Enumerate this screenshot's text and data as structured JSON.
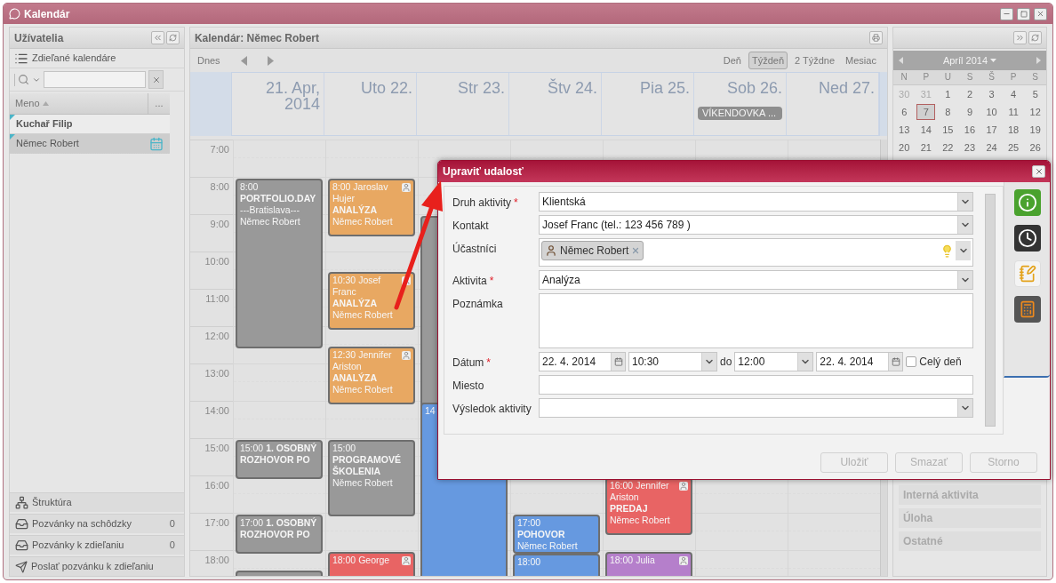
{
  "window": {
    "title": "Kalendár"
  },
  "users_panel": {
    "title": "Užívatelia",
    "shared_calendars": "Zdieľané kalendáre",
    "column": "Meno",
    "column_more": "...",
    "users": [
      {
        "name": "Kuchař Filip",
        "kind": "owner",
        "selected": false
      },
      {
        "name": "Němec Robert",
        "kind": "shared",
        "selected": true
      }
    ],
    "links": [
      {
        "label": "Štruktúra",
        "kind": "structure"
      },
      {
        "label": "Pozvánky na schôdzky",
        "kind": "inbox",
        "count": "0"
      },
      {
        "label": "Pozvánky k zdieľaniu",
        "kind": "inbox",
        "count": "0"
      },
      {
        "label": "Poslať pozvánku k zdieľaniu",
        "kind": "send"
      }
    ]
  },
  "calendar": {
    "title": "Kalendár: Němec Robert",
    "today": "Dnes",
    "views": [
      {
        "label": "Deň",
        "selected": false
      },
      {
        "label": "Týždeň",
        "selected": true
      },
      {
        "label": "2 Týždne",
        "selected": false
      },
      {
        "label": "Mesiac",
        "selected": false
      }
    ],
    "days": [
      {
        "label": "21. Apr, 2014"
      },
      {
        "label": "Uto 22."
      },
      {
        "label": "Str 23."
      },
      {
        "label": "Štv 24."
      },
      {
        "label": "Pia 25."
      },
      {
        "label": "Sob 26.",
        "all_day": "VÍKENDOVKA ..."
      },
      {
        "label": "Ned 27."
      }
    ],
    "hours": [
      "7:00",
      "8:00",
      "9:00",
      "10:00",
      "11:00",
      "12:00",
      "13:00",
      "14:00",
      "15:00",
      "16:00",
      "17:00",
      "18:00"
    ],
    "events": [
      {
        "color": "#999999",
        "lines": [
          "8:00",
          "**PORTFOLIO.DAY**",
          "---Bratislava---",
          "Němec Robert"
        ]
      },
      {
        "color": "#999999",
        "lines": [
          "15:00  **1. OSOBNÝ ROZHOVOR PO**"
        ]
      },
      {
        "color": "#999999",
        "lines": [
          "17:00  **1. OSOBNÝ ROZHOVOR PO**"
        ]
      },
      {
        "color": "#999999"
      },
      {
        "color": "#e8a862",
        "shared": true,
        "lines": [
          "8:00 Jaroslav Hujer **ANALÝZA**",
          "Němec Robert"
        ]
      },
      {
        "color": "#e8a862",
        "shared": true,
        "lines": [
          "10:30 Josef Franc **ANALÝZA**",
          "Němec Robert"
        ]
      },
      {
        "color": "#e8a862",
        "shared": true,
        "lines": [
          "12:30 Jennifer Ariston **ANALÝZA**",
          "Němec Robert"
        ]
      },
      {
        "color": "#999999",
        "lines": [
          "15:00",
          "**PROGRAMOVÉ ŠKOLENIA**",
          "Němec Robert"
        ]
      },
      {
        "color": "#e86464",
        "shared": true,
        "lines": [
          "18:00 George"
        ]
      },
      {
        "color": "#999999"
      },
      {
        "color": "#6699e0",
        "lines": [
          "14"
        ]
      },
      {
        "color": "#6699e0",
        "lines": [
          "17:00",
          "**POHOVOR**",
          "Němec Robert"
        ]
      },
      {
        "color": "#6699e0",
        "lines": [
          "18:00"
        ]
      },
      {
        "color": "#e86464",
        "shared": true,
        "lines": [
          "16:00 Jennifer Ariston **PREDAJ**",
          "Němec Robert"
        ]
      },
      {
        "color": "#b57fcb",
        "shared": true,
        "lines": [
          "18:00 Julia"
        ]
      }
    ]
  },
  "mini_calendar": {
    "title": "Apríl 2014",
    "weekdays": [
      "N",
      "P",
      "U",
      "S",
      "Š",
      "P",
      "S"
    ],
    "weeks": [
      [
        {
          "label": "30",
          "other_month": true,
          "today": false
        },
        {
          "label": "31",
          "other_month": true,
          "today": false
        },
        {
          "label": "1",
          "other_month": false,
          "today": false
        },
        {
          "label": "2",
          "other_month": false,
          "today": false
        },
        {
          "label": "3",
          "other_month": false,
          "today": false
        },
        {
          "label": "4",
          "other_month": false,
          "today": false
        },
        {
          "label": "5",
          "other_month": false,
          "today": false
        }
      ],
      [
        {
          "label": "6",
          "other_month": false,
          "today": false
        },
        {
          "label": "7",
          "other_month": false,
          "today": true
        },
        {
          "label": "8",
          "other_month": false,
          "today": false
        },
        {
          "label": "9",
          "other_month": false,
          "today": false
        },
        {
          "label": "10",
          "other_month": false,
          "today": false
        },
        {
          "label": "11",
          "other_month": false,
          "today": false
        },
        {
          "label": "12",
          "other_month": false,
          "today": false
        }
      ],
      [
        {
          "label": "13",
          "other_month": false,
          "today": false
        },
        {
          "label": "14",
          "other_month": false,
          "today": false
        },
        {
          "label": "15",
          "other_month": false,
          "today": false
        },
        {
          "label": "16",
          "other_month": false,
          "today": false
        },
        {
          "label": "17",
          "other_month": false,
          "today": false
        },
        {
          "label": "18",
          "other_month": false,
          "today": false
        },
        {
          "label": "19",
          "other_month": false,
          "today": false
        }
      ],
      [
        {
          "label": "20",
          "other_month": false,
          "today": false
        },
        {
          "label": "21",
          "other_month": false,
          "today": false
        },
        {
          "label": "22",
          "other_month": false,
          "today": false
        },
        {
          "label": "23",
          "other_month": false,
          "today": false
        },
        {
          "label": "24",
          "other_month": false,
          "today": false
        },
        {
          "label": "25",
          "other_month": false,
          "today": false
        },
        {
          "label": "26",
          "other_month": false,
          "today": false
        }
      ]
    ],
    "categories": [
      "Interná aktivita",
      "Úloha",
      "Ostatné"
    ]
  },
  "dialog": {
    "title": "Upraviť udalosť",
    "fields": [
      {
        "kind": "select",
        "label": "Druh aktivity",
        "mark": "*",
        "value": "Klientská"
      },
      {
        "kind": "select",
        "label": "Kontakt",
        "value": "Josef Franc (tel.: 123 456 789 )"
      },
      {
        "kind": "tags",
        "label": "Účastníci",
        "tags": [
          "Němec Robert"
        ]
      },
      {
        "kind": "select",
        "label": "Aktivita",
        "mark": "*",
        "value": "Analýza"
      },
      {
        "kind": "textarea",
        "label": "Poznámka"
      },
      {
        "kind": "date_range",
        "label": "Dátum",
        "mark": "*",
        "start_date": "22. 4. 2014",
        "start_time": "10:30",
        "separator": "do",
        "end_time": "12:00",
        "end_date": "22. 4. 2014",
        "all_day": {
          "label": "Celý deň",
          "checked": false
        }
      },
      {
        "kind": "text",
        "label": "Miesto"
      },
      {
        "kind": "select",
        "label": "Výsledok aktivity"
      }
    ],
    "buttons": [
      {
        "label": "Uložiť",
        "disabled": true
      },
      {
        "label": "Smazať",
        "disabled": true
      },
      {
        "label": "Storno",
        "disabled": true
      }
    ]
  }
}
